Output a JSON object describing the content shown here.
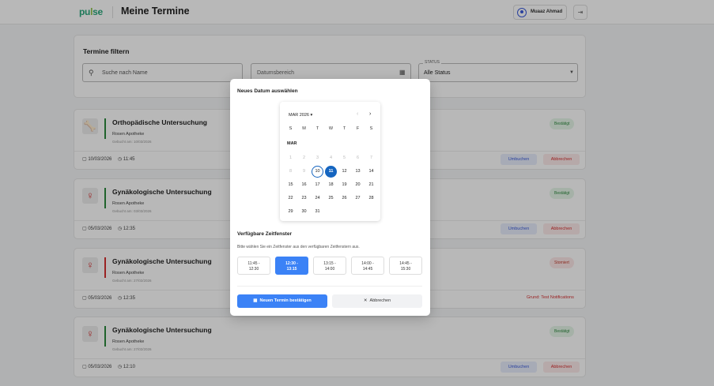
{
  "app": {
    "logo": "pulse",
    "title": "Meine Termine",
    "user_name": "Muaaz Ahmad",
    "logout_icon": "logout-icon"
  },
  "filter": {
    "title": "Termine filtern",
    "search_placeholder": "Suche nach Name",
    "date_placeholder": "Datumsbereich",
    "status_label": "STATUS",
    "status_value": "Alle Status"
  },
  "appointments": [
    {
      "title": "Orthopädische Untersuchung",
      "pharmacy": "Rosen Apotheke",
      "booked": "Gebucht am: 10/03/2026",
      "date": "10/03/2026",
      "time": "11:45",
      "status": "Bestätigt",
      "status_type": "ok",
      "reschedule": "Umbuchen",
      "cancel": "Abbrechen",
      "accent": "#2d8a3e"
    },
    {
      "title": "Gynäkologische Untersuchung",
      "pharmacy": "Rosen Apotheke",
      "booked": "Gebucht am: 03/03/2026",
      "date": "05/03/2026",
      "time": "12:35",
      "status": "Bestätigt",
      "status_type": "ok",
      "reschedule": "Umbuchen",
      "cancel": "Abbrechen",
      "accent": "#2d8a3e"
    },
    {
      "title": "Gynäkologische Untersuchung",
      "pharmacy": "Rosen Apotheke",
      "booked": "Gebucht am: 27/02/2026",
      "date": "05/03/2026",
      "time": "12:35",
      "status": "Storniert",
      "status_type": "cancel",
      "reason": "Grund: Test Notifications",
      "accent": "#d63031"
    },
    {
      "title": "Gynäkologische Untersuchung",
      "pharmacy": "Rosen Apotheke",
      "booked": "Gebucht am: 27/02/2026",
      "date": "05/03/2026",
      "time": "12:10",
      "status": "Bestätigt",
      "status_type": "ok",
      "reschedule": "Umbuchen",
      "cancel": "Abbrechen",
      "accent": "#2d8a3e"
    }
  ],
  "modal": {
    "title": "Neues Datum auswählen",
    "calendar": {
      "month_label": "MAR 2026",
      "section_label": "MAR",
      "weekdays": [
        "S",
        "M",
        "T",
        "W",
        "T",
        "F",
        "S"
      ],
      "today": 10,
      "selected": 11,
      "last_disabled": 9,
      "days": 31
    },
    "slots_title": "Verfügbare Zeitfenster",
    "slots_hint": "Bitte wählen Sie ein Zeitfenster aus den verfügbaren Zeitfenstern aus.",
    "slots": [
      {
        "line1": "11:45 -",
        "line2": "12:30"
      },
      {
        "line1": "12:30 -",
        "line2": "13:15"
      },
      {
        "line1": "13:15 -",
        "line2": "14:00"
      },
      {
        "line1": "14:00 -",
        "line2": "14:45"
      },
      {
        "line1": "14:45 -",
        "line2": "15:30"
      }
    ],
    "selected_slot": 1,
    "confirm_label": "Neuen Termin bestätigen",
    "abort_label": "Abbrechen"
  },
  "colors": {
    "primary": "#3b82f6",
    "calendar_selected": "#1565c0",
    "success": "#2d8a3e",
    "danger": "#d63031"
  }
}
